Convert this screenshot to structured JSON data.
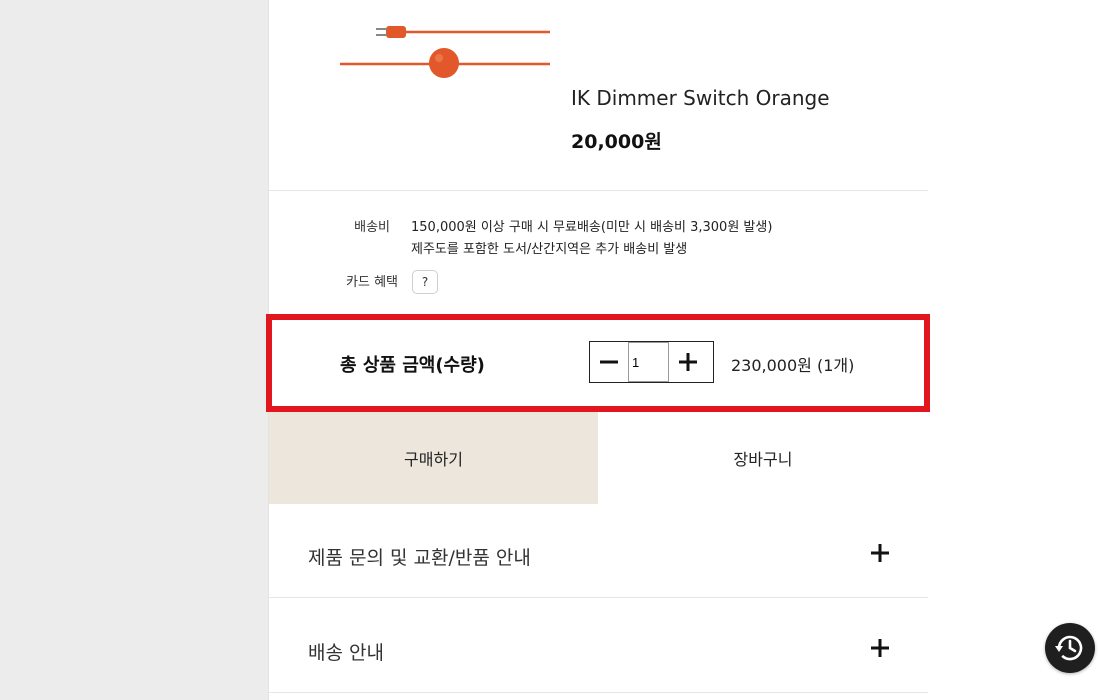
{
  "product": {
    "name": "IK Dimmer Switch Orange",
    "price": "20,000원",
    "color": "#e2582a"
  },
  "shipping": {
    "label": "배송비",
    "line1": "150,000원 이상 구매 시 무료배송(미만 시 배송비 3,300원 발생)",
    "line2": "제주도를 포함한 도서/산간지역은 추가 배송비 발생"
  },
  "card_benefit": {
    "label": "카드 혜택",
    "help": "?"
  },
  "total": {
    "label": "총 상품 금액(수량)",
    "quantity": "1",
    "amount": "230,000원 (1개)",
    "highlight_color": "#e2161e"
  },
  "actions": {
    "buy": "구매하기",
    "cart": "장바구니",
    "buy_bg": "#ede6dc"
  },
  "accordions": [
    {
      "label": "제품 문의 및 교환/반품 안내"
    },
    {
      "label": "배송 안내"
    }
  ],
  "icons": {
    "minus": "minus-icon",
    "plus": "plus-icon",
    "history": "history-clock-icon"
  }
}
